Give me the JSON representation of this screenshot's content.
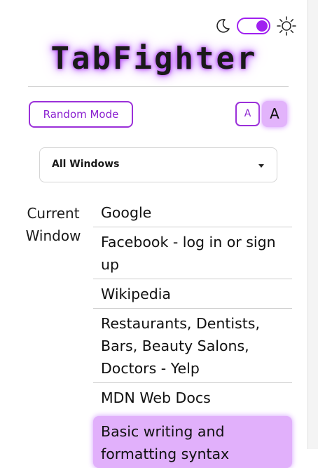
{
  "theme_toggle": {
    "moon_icon": "moon-icon",
    "sun_icon": "sun-icon",
    "state": "dark-on",
    "accent": "#a020f0"
  },
  "app": {
    "title": "TabFighter"
  },
  "controls": {
    "random_mode_label": "Random Mode",
    "font_small_label": "A",
    "font_large_label": "A"
  },
  "window_select": {
    "selected": "All Windows"
  },
  "groups": [
    {
      "label": "Current Window",
      "tabs": [
        {
          "title": "Google"
        },
        {
          "title": "Facebook - log in or sign up"
        },
        {
          "title": "Wikipedia"
        },
        {
          "title": "Restaurants, Dentists, Bars, Beauty Salons, Doctors - Yelp"
        },
        {
          "title": "MDN Web Docs"
        },
        {
          "title": "Basic writing and formatting syntax"
        }
      ]
    }
  ],
  "colors": {
    "accent": "#9b30d9",
    "highlight": "#e1b0fb"
  }
}
